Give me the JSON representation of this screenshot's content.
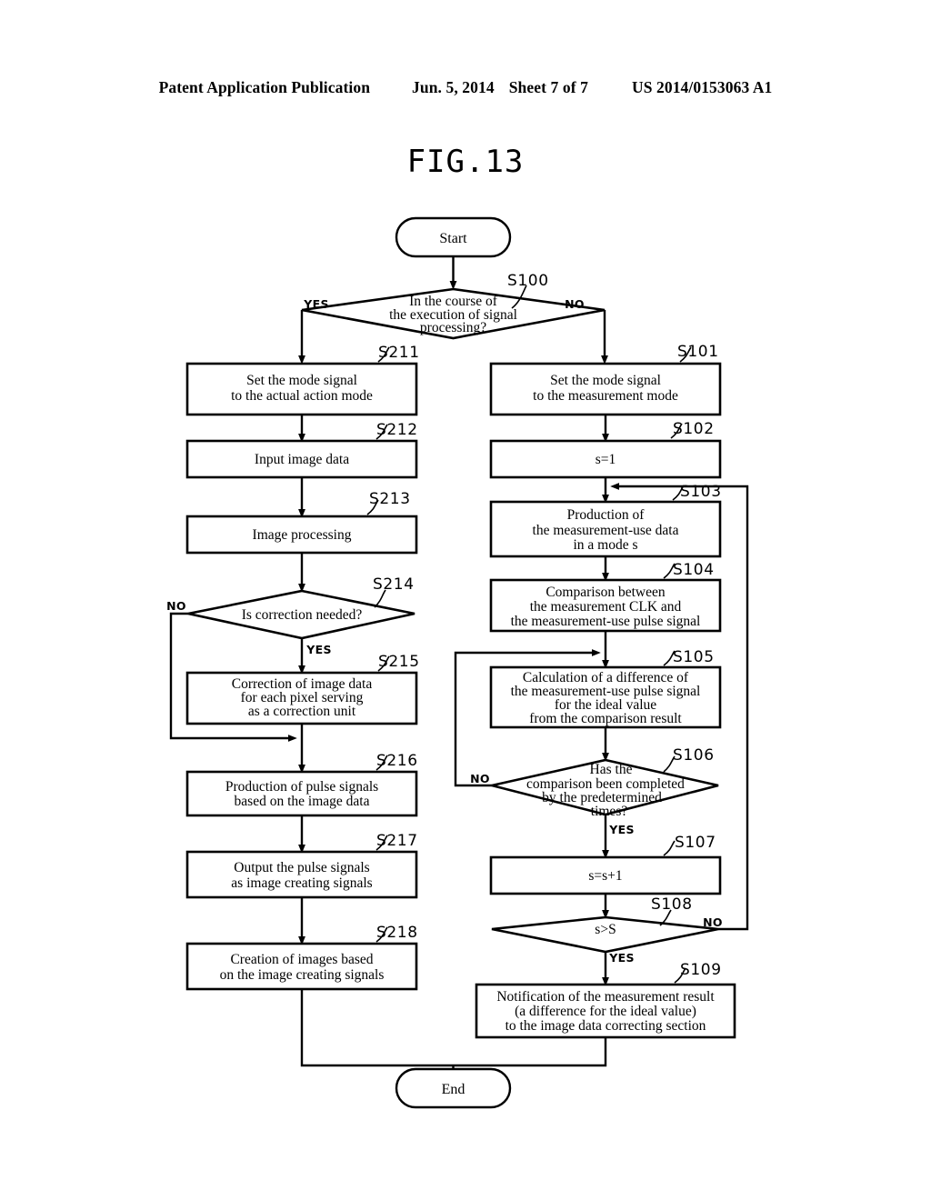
{
  "header": {
    "publication": "Patent Application Publication",
    "date": "Jun. 5, 2014",
    "sheet": "Sheet 7 of 7",
    "number": "US 2014/0153063 A1"
  },
  "figure": {
    "title": "FIG.13"
  },
  "chart_data": {
    "type": "diagram",
    "diagram_kind": "flowchart",
    "title": "FIG.13",
    "terminals": [
      {
        "id": "start",
        "label": "Start"
      },
      {
        "id": "end",
        "label": "End"
      }
    ],
    "nodes": [
      {
        "step": "S100",
        "kind": "decision",
        "lines": [
          "In the course of",
          "the execution of signal",
          "processing?"
        ],
        "branches": [
          "YES",
          "NO"
        ]
      },
      {
        "step": "S211",
        "kind": "process",
        "lines": [
          "Set the mode signal",
          "to the actual action mode"
        ]
      },
      {
        "step": "S212",
        "kind": "process",
        "lines": [
          "Input image data"
        ]
      },
      {
        "step": "S213",
        "kind": "process",
        "lines": [
          "Image processing"
        ]
      },
      {
        "step": "S214",
        "kind": "decision",
        "lines": [
          "Is correction needed?"
        ],
        "branches": [
          "NO",
          "YES"
        ]
      },
      {
        "step": "S215",
        "kind": "process",
        "lines": [
          "Correction of image data",
          "for each pixel serving",
          "as a correction unit"
        ]
      },
      {
        "step": "S216",
        "kind": "process",
        "lines": [
          "Production of pulse signals",
          "based on the image data"
        ]
      },
      {
        "step": "S217",
        "kind": "process",
        "lines": [
          "Output the pulse signals",
          "as image creating signals"
        ]
      },
      {
        "step": "S218",
        "kind": "process",
        "lines": [
          "Creation of images based",
          "on the image creating signals"
        ]
      },
      {
        "step": "S101",
        "kind": "process",
        "lines": [
          "Set the mode signal",
          "to the measurement mode"
        ]
      },
      {
        "step": "S102",
        "kind": "process",
        "lines": [
          "s=1"
        ]
      },
      {
        "step": "S103",
        "kind": "process",
        "lines": [
          "Production of",
          "the measurement-use data",
          "in a mode s"
        ]
      },
      {
        "step": "S104",
        "kind": "process",
        "lines": [
          "Comparison between",
          "the measurement CLK and",
          "the measurement-use pulse signal"
        ]
      },
      {
        "step": "S105",
        "kind": "process",
        "lines": [
          "Calculation of a difference of",
          "the measurement-use pulse signal",
          "for the ideal value",
          "from the comparison result"
        ]
      },
      {
        "step": "S106",
        "kind": "decision",
        "lines": [
          "Has the",
          "comparison been completed",
          "by the predetermined",
          "times?"
        ],
        "branches": [
          "NO",
          "YES"
        ]
      },
      {
        "step": "S107",
        "kind": "process",
        "lines": [
          "s=s+1"
        ]
      },
      {
        "step": "S108",
        "kind": "decision",
        "lines": [
          "s>S"
        ],
        "branches": [
          "NO",
          "YES"
        ]
      },
      {
        "step": "S109",
        "kind": "process",
        "lines": [
          "Notification of the measurement result",
          "(a difference for the ideal value)",
          "to the image data correcting section"
        ]
      }
    ],
    "edge_labels": {
      "s100_yes": "YES",
      "s100_no": "NO",
      "s214_no": "NO",
      "s214_yes": "YES",
      "s106_no": "NO",
      "s106_yes": "YES",
      "s108_no": "NO",
      "s108_yes": "YES"
    },
    "colors": {
      "stroke": "#000000",
      "fill": "#ffffff",
      "text": "#000000"
    }
  }
}
